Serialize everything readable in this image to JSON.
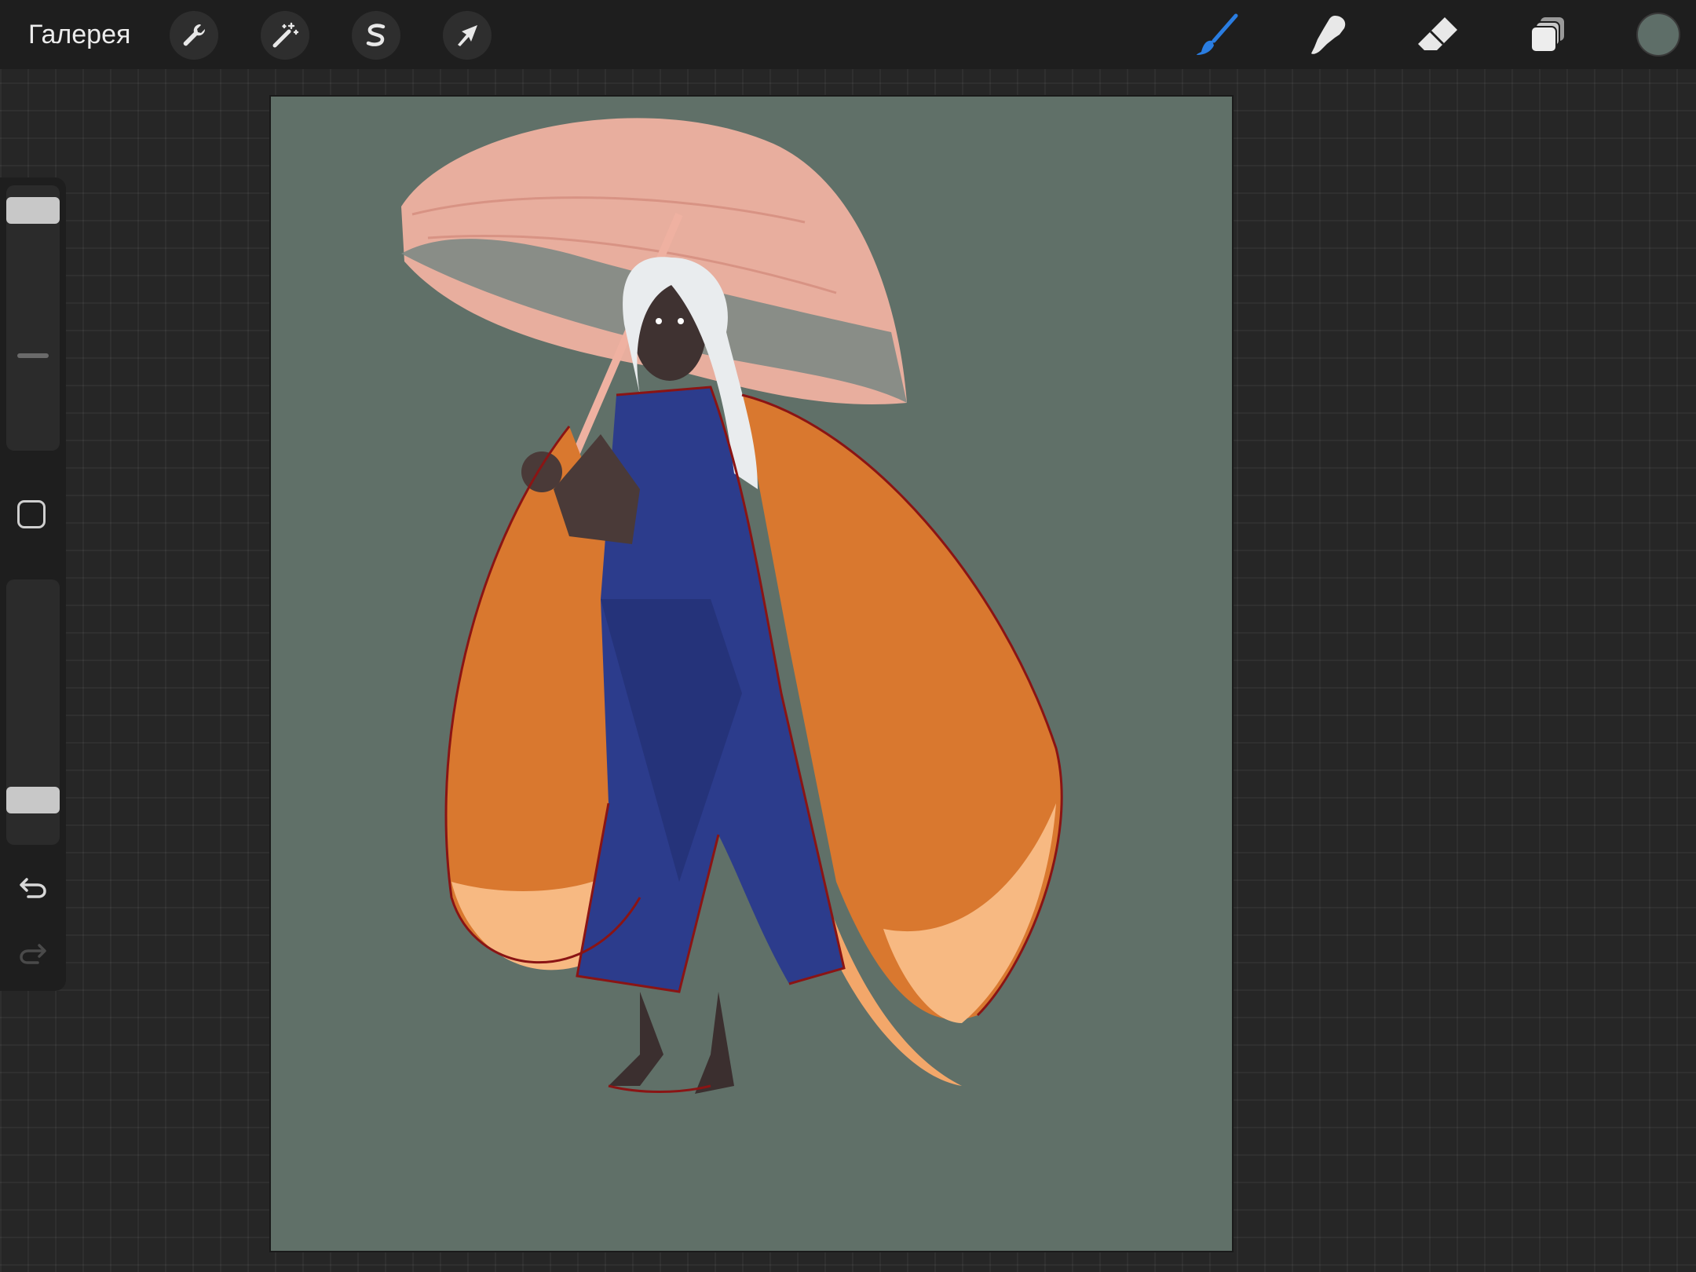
{
  "topbar": {
    "gallery_label": "Галерея",
    "left_tools": [
      {
        "name": "actions",
        "icon": "wrench-icon"
      },
      {
        "name": "adjustments",
        "icon": "magic-wand-icon"
      },
      {
        "name": "selection",
        "icon": "selection-s-icon"
      },
      {
        "name": "transform",
        "icon": "arrow-cursor-icon"
      }
    ],
    "right_tools": [
      {
        "name": "brush",
        "icon": "brush-icon",
        "active": true
      },
      {
        "name": "smudge",
        "icon": "smudge-finger-icon"
      },
      {
        "name": "eraser",
        "icon": "eraser-icon"
      },
      {
        "name": "layers",
        "icon": "layers-icon"
      }
    ],
    "current_color": "#5e6e68"
  },
  "sidebar": {
    "brush_size": 0.95,
    "brush_opacity": 0.13,
    "modifier_icon": "square-icon",
    "undo_icon": "undo-icon",
    "redo_icon": "redo-icon"
  },
  "colors": {
    "accent": "#2a7de1",
    "canvas_bg": "#607068"
  }
}
